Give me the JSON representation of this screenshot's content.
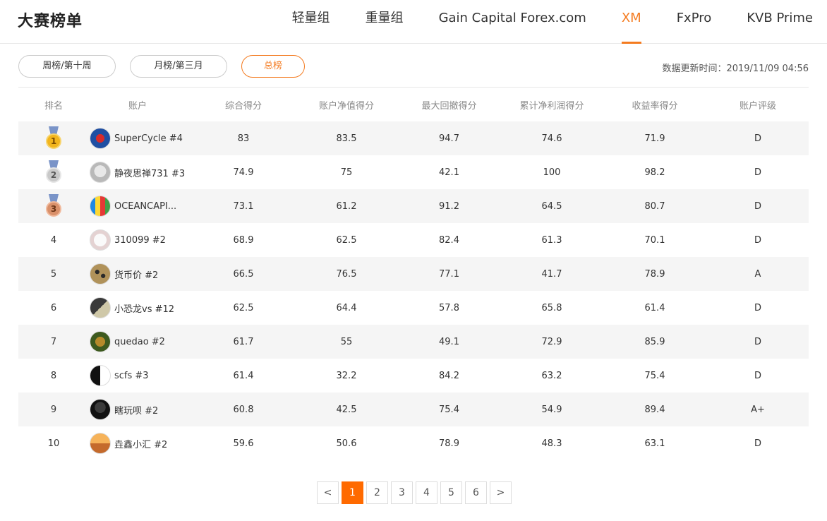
{
  "header": {
    "title": "大赛榜单",
    "tabs": [
      "轻量组",
      "重量组",
      "Gain Capital Forex.com",
      "XM",
      "FxPro",
      "KVB Prime"
    ],
    "active_tab": "XM"
  },
  "filters": {
    "weekly": "周榜/第十周",
    "monthly": "月榜/第三月",
    "total": "总榜",
    "active": "总榜"
  },
  "update_time": "数据更新时间：2019/11/09 04:56",
  "table": {
    "columns": [
      "排名",
      "账户",
      "综合得分",
      "账户净值得分",
      "最大回撤得分",
      "累计净利润得分",
      "收益率得分",
      "账户评级"
    ],
    "rows": [
      {
        "rank": "1",
        "medal": "gold",
        "avatar": "superman-avatar",
        "account": "SuperCycle #4",
        "s1": "83",
        "s2": "83.5",
        "s3": "94.7",
        "s4": "74.6",
        "s5": "71.9",
        "grade": "D"
      },
      {
        "rank": "2",
        "medal": "silver",
        "avatar": "rabbit-avatar",
        "account": "静夜思禅731 #3",
        "s1": "74.9",
        "s2": "75",
        "s3": "42.1",
        "s4": "100",
        "s5": "98.2",
        "grade": "D"
      },
      {
        "rank": "3",
        "medal": "bronze",
        "avatar": "rainbow-avatar",
        "account": "OCEANCAPI...",
        "s1": "73.1",
        "s2": "61.2",
        "s3": "91.2",
        "s4": "64.5",
        "s5": "80.7",
        "grade": "D"
      },
      {
        "rank": "4",
        "medal": "",
        "avatar": "bunny-avatar",
        "account": "310099 #2",
        "s1": "68.9",
        "s2": "62.5",
        "s3": "82.4",
        "s4": "61.3",
        "s5": "70.1",
        "grade": "D"
      },
      {
        "rank": "5",
        "medal": "",
        "avatar": "leopard-avatar",
        "account": "货币价 #2",
        "s1": "66.5",
        "s2": "76.5",
        "s3": "77.1",
        "s4": "41.7",
        "s5": "78.9",
        "grade": "A"
      },
      {
        "rank": "6",
        "medal": "",
        "avatar": "dinosaur-avatar",
        "account": "小恐龙vs #12",
        "s1": "62.5",
        "s2": "64.4",
        "s3": "57.8",
        "s4": "65.8",
        "s5": "61.4",
        "grade": "D"
      },
      {
        "rank": "7",
        "medal": "",
        "avatar": "dragon-avatar",
        "account": "quedao #2",
        "s1": "61.7",
        "s2": "55",
        "s3": "49.1",
        "s4": "72.9",
        "s5": "85.9",
        "grade": "D"
      },
      {
        "rank": "8",
        "medal": "",
        "avatar": "yinyang-avatar",
        "account": "scfs #3",
        "s1": "61.4",
        "s2": "32.2",
        "s3": "84.2",
        "s4": "63.2",
        "s5": "75.4",
        "grade": "D"
      },
      {
        "rank": "9",
        "medal": "",
        "avatar": "person-avatar",
        "account": "瞎玩呗 #2",
        "s1": "60.8",
        "s2": "42.5",
        "s3": "75.4",
        "s4": "54.9",
        "s5": "89.4",
        "grade": "A+"
      },
      {
        "rank": "10",
        "medal": "",
        "avatar": "sunset-avatar",
        "account": "垚鑫小汇 #2",
        "s1": "59.6",
        "s2": "50.6",
        "s3": "78.9",
        "s4": "48.3",
        "s5": "63.1",
        "grade": "D"
      }
    ]
  },
  "pagination": {
    "prev": "<",
    "pages": [
      "1",
      "2",
      "3",
      "4",
      "5",
      "6"
    ],
    "current": "1",
    "next": ">"
  },
  "colors": {
    "accent": "#f47b20",
    "page_active": "#ff6a00",
    "row_alt": "#f5f5f5"
  }
}
